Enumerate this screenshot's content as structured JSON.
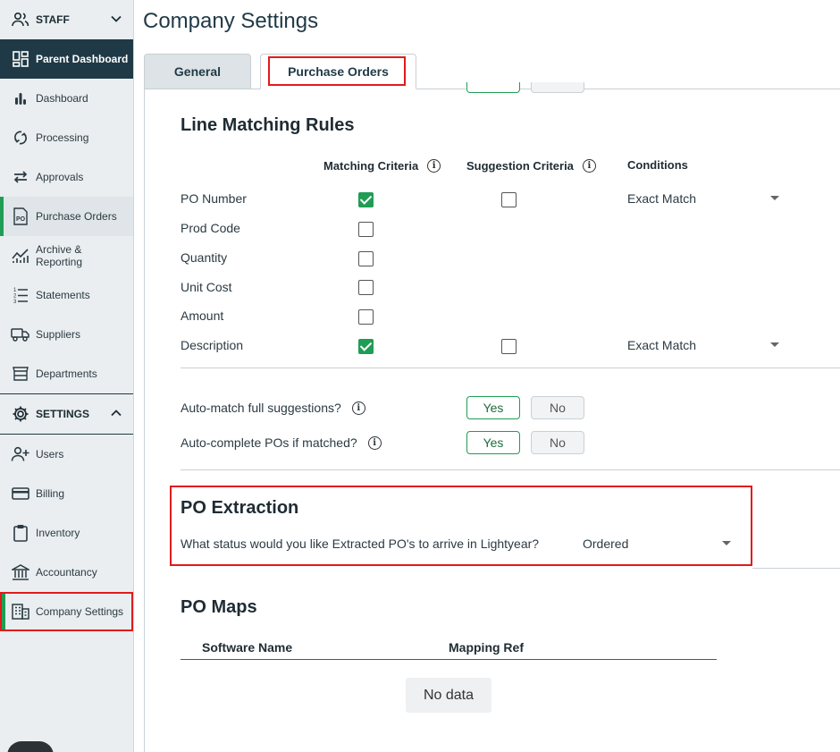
{
  "sidebar": {
    "staff_label": "STAFF",
    "settings_label": "SETTINGS",
    "items": {
      "parent_dashboard": "Parent Dashboard",
      "dashboard": "Dashboard",
      "processing": "Processing",
      "approvals": "Approvals",
      "purchase_orders": "Purchase Orders",
      "archive_line1": "Archive &",
      "archive_line2": "Reporting",
      "statements": "Statements",
      "suppliers": "Suppliers",
      "departments": "Departments",
      "users": "Users",
      "billing": "Billing",
      "inventory": "Inventory",
      "accountancy": "Accountancy",
      "company_settings": "Company Settings"
    },
    "po_icon_text": "PO"
  },
  "main": {
    "title": "Company Settings",
    "tabs": {
      "general": "General",
      "purchase_orders": "Purchase Orders"
    },
    "line_matching": {
      "title": "Line Matching Rules",
      "col_matching": "Matching Criteria",
      "col_suggestion": "Suggestion Criteria",
      "col_conditions": "Conditions",
      "rows": [
        {
          "label": "PO Number",
          "matching": true,
          "suggestion": false,
          "condition": "Exact Match"
        },
        {
          "label": "Prod Code",
          "matching": false
        },
        {
          "label": "Quantity",
          "matching": false
        },
        {
          "label": "Unit Cost",
          "matching": false
        },
        {
          "label": "Amount",
          "matching": false
        },
        {
          "label": "Description",
          "matching": true,
          "suggestion": false,
          "condition": "Exact Match"
        }
      ]
    },
    "questions": {
      "auto_match": "Auto-match full suggestions?",
      "auto_complete": "Auto-complete POs if matched?",
      "yes": "Yes",
      "no": "No"
    },
    "po_extraction": {
      "title": "PO Extraction",
      "question": "What status would you like Extracted PO's to arrive in Lightyear?",
      "value": "Ordered"
    },
    "po_maps": {
      "title": "PO Maps",
      "col_software": "Software Name",
      "col_mapping": "Mapping Ref",
      "empty": "No data"
    }
  },
  "colors": {
    "accent_green": "#1f9d55",
    "nav_dark": "#1f3a46",
    "highlight_red": "#e01b1b"
  }
}
